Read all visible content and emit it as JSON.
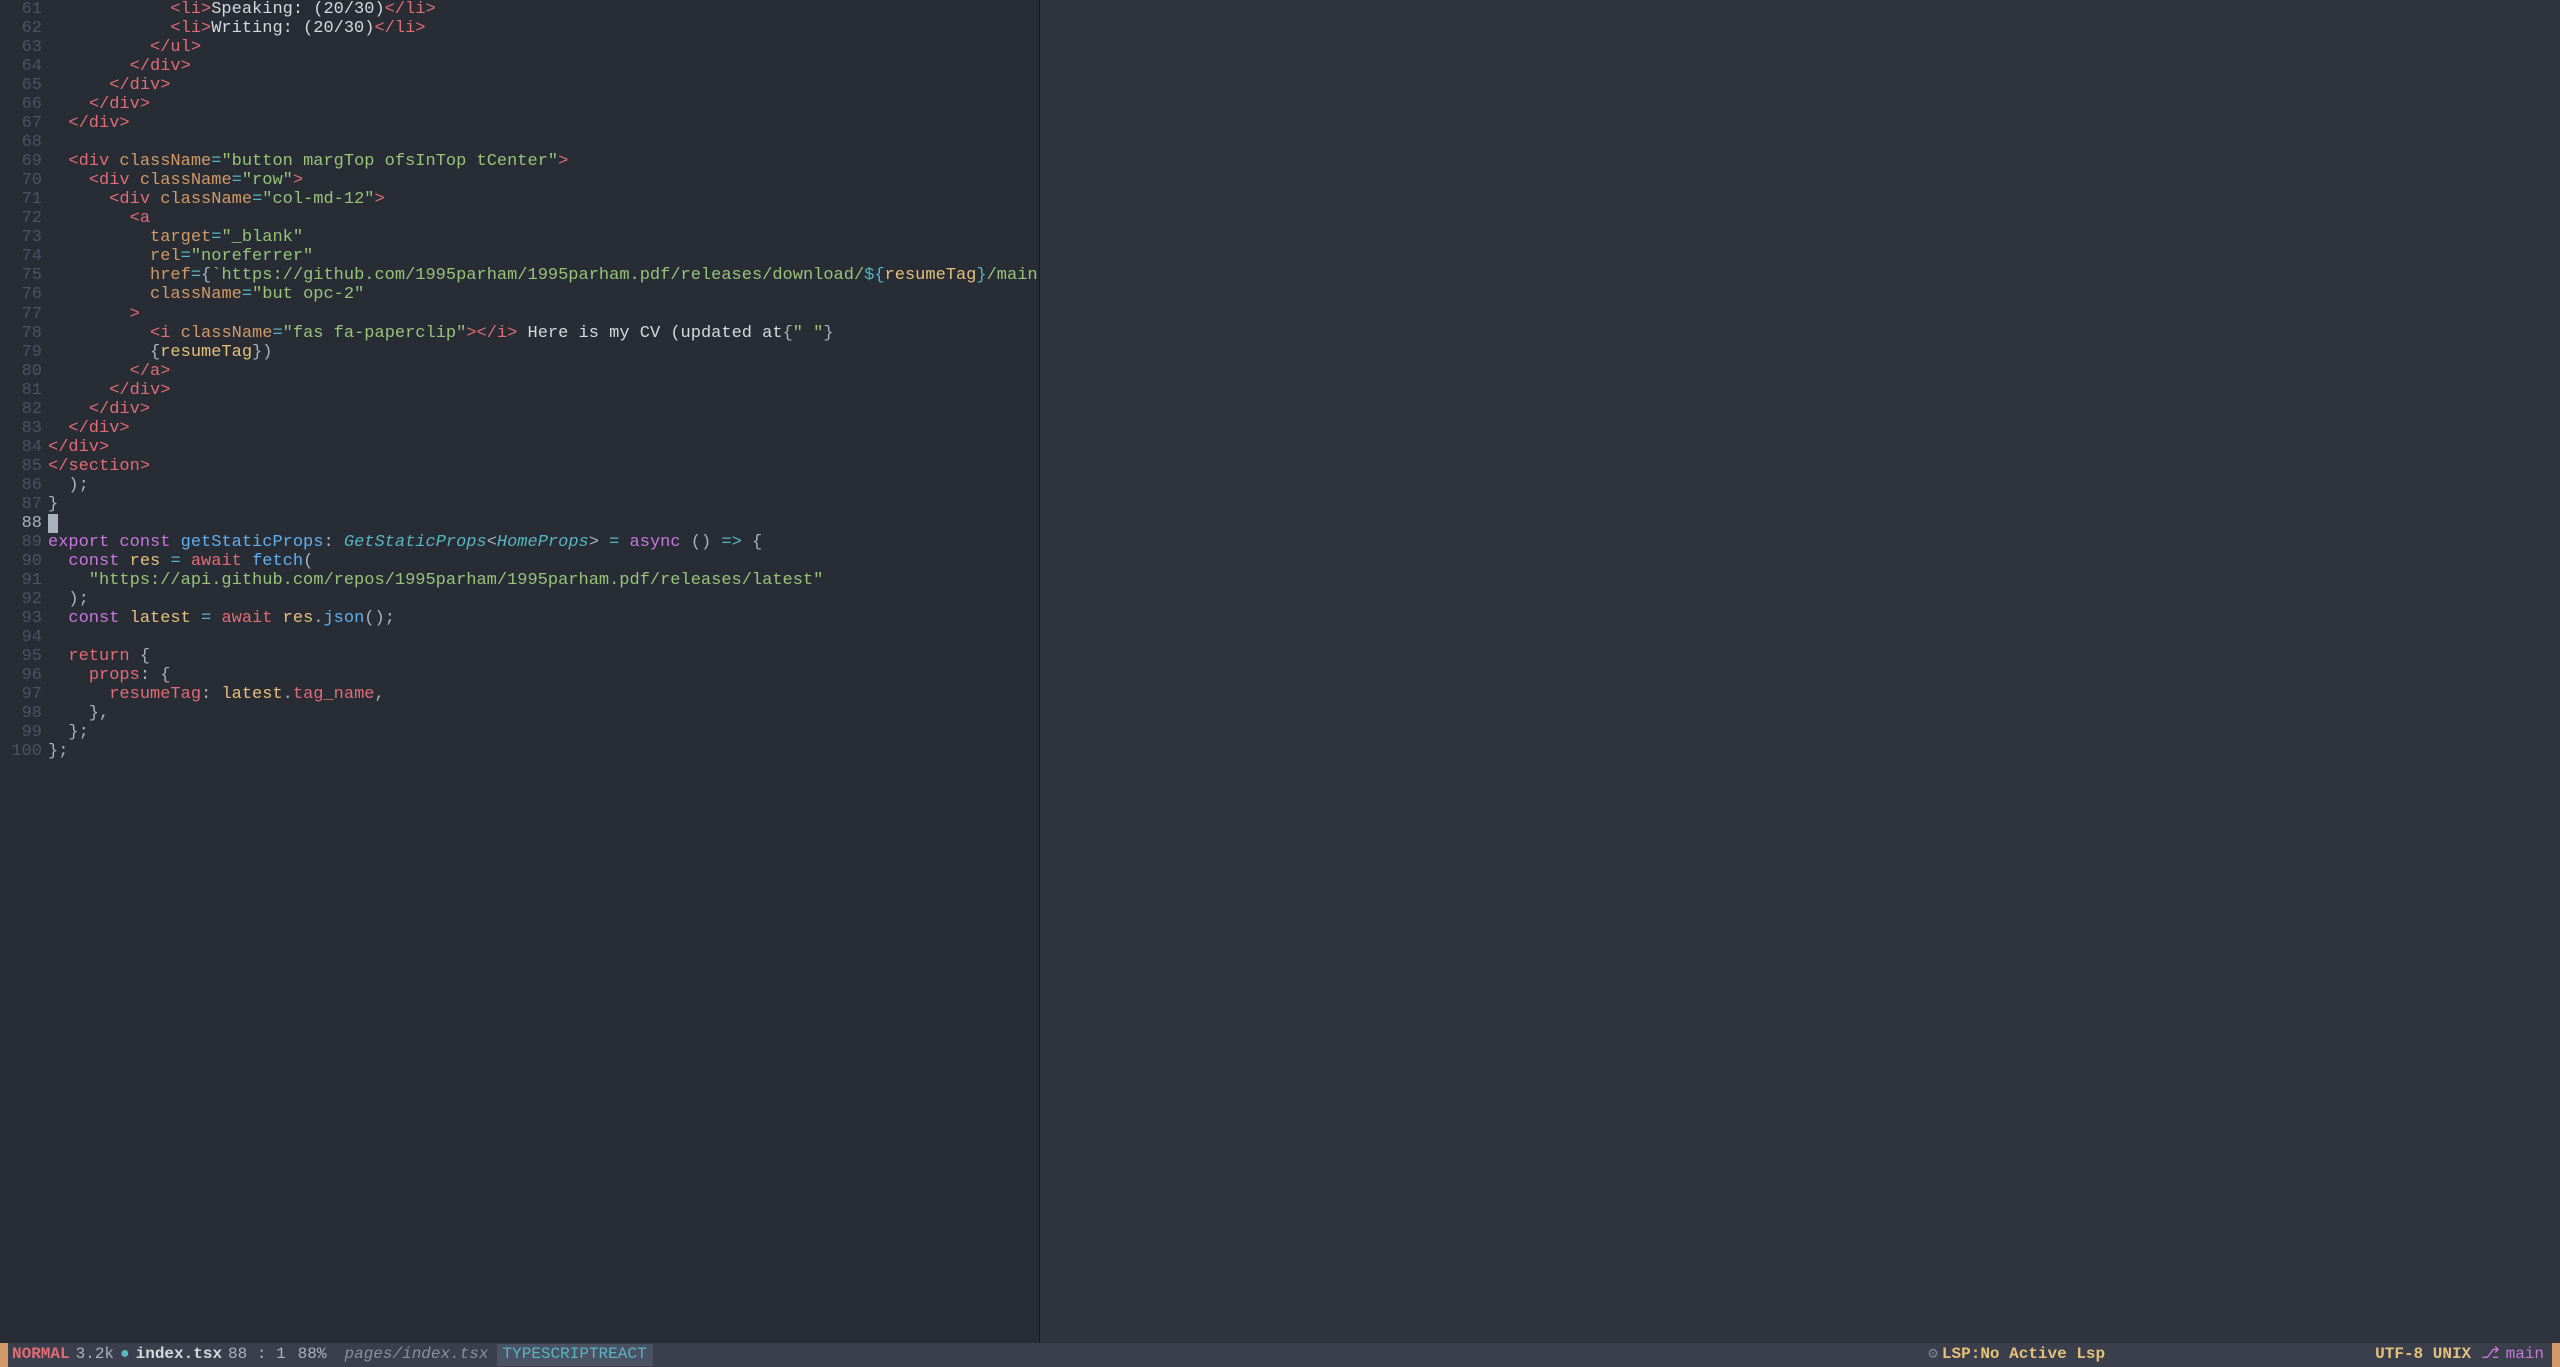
{
  "status": {
    "mode": "NORMAL",
    "filesize": "3.2k",
    "modified_dot": "●",
    "filename": "index.tsx",
    "line": "88",
    "col": "1",
    "percent": "88%",
    "relpath": "pages/index.tsx",
    "filetype": "TYPESCRIPTREACT",
    "lsp_icon": "⚙",
    "lsp": "LSP:No Active Lsp",
    "encoding": "UTF-8 UNIX",
    "branch_icon": "⎇",
    "branch": "main"
  },
  "cursor_line": 88,
  "lines": [
    {
      "n": 61,
      "tokens": [
        [
          "c-punct",
          "            "
        ],
        [
          "c-tag",
          "<li>"
        ],
        [
          "c-text",
          "Speaking: (20/30)"
        ],
        [
          "c-tag",
          "</li>"
        ]
      ]
    },
    {
      "n": 62,
      "tokens": [
        [
          "c-punct",
          "            "
        ],
        [
          "c-tag",
          "<li>"
        ],
        [
          "c-text",
          "Writing: (20/30)"
        ],
        [
          "c-tag",
          "</li>"
        ]
      ]
    },
    {
      "n": 63,
      "tokens": [
        [
          "c-punct",
          "          "
        ],
        [
          "c-tag",
          "</ul>"
        ]
      ]
    },
    {
      "n": 64,
      "tokens": [
        [
          "c-punct",
          "        "
        ],
        [
          "c-tag",
          "</div>"
        ]
      ]
    },
    {
      "n": 65,
      "tokens": [
        [
          "c-punct",
          "      "
        ],
        [
          "c-tag",
          "</div>"
        ]
      ]
    },
    {
      "n": 66,
      "tokens": [
        [
          "c-punct",
          "    "
        ],
        [
          "c-tag",
          "</div>"
        ]
      ]
    },
    {
      "n": 67,
      "tokens": [
        [
          "c-punct",
          "  "
        ],
        [
          "c-tag",
          "</div>"
        ]
      ]
    },
    {
      "n": 68,
      "tokens": []
    },
    {
      "n": 69,
      "tokens": [
        [
          "c-punct",
          "  "
        ],
        [
          "c-tag",
          "<div "
        ],
        [
          "c-attr",
          "className"
        ],
        [
          "c-op",
          "="
        ],
        [
          "c-str",
          "\"button margTop ofsInTop tCenter\""
        ],
        [
          "c-tag",
          ">"
        ]
      ]
    },
    {
      "n": 70,
      "tokens": [
        [
          "c-punct",
          "    "
        ],
        [
          "c-tag",
          "<div "
        ],
        [
          "c-attr",
          "className"
        ],
        [
          "c-op",
          "="
        ],
        [
          "c-str",
          "\"row\""
        ],
        [
          "c-tag",
          ">"
        ]
      ]
    },
    {
      "n": 71,
      "tokens": [
        [
          "c-punct",
          "      "
        ],
        [
          "c-tag",
          "<div "
        ],
        [
          "c-attr",
          "className"
        ],
        [
          "c-op",
          "="
        ],
        [
          "c-str",
          "\"col-md-12\""
        ],
        [
          "c-tag",
          ">"
        ]
      ]
    },
    {
      "n": 72,
      "tokens": [
        [
          "c-punct",
          "        "
        ],
        [
          "c-tag",
          "<a"
        ]
      ]
    },
    {
      "n": 73,
      "tokens": [
        [
          "c-punct",
          "          "
        ],
        [
          "c-attr",
          "target"
        ],
        [
          "c-op",
          "="
        ],
        [
          "c-str",
          "\"_blank\""
        ]
      ]
    },
    {
      "n": 74,
      "tokens": [
        [
          "c-punct",
          "          "
        ],
        [
          "c-attr",
          "rel"
        ],
        [
          "c-op",
          "="
        ],
        [
          "c-str",
          "\"noreferrer\""
        ]
      ]
    },
    {
      "n": 75,
      "tokens": [
        [
          "c-punct",
          "          "
        ],
        [
          "c-attr",
          "href"
        ],
        [
          "c-op",
          "="
        ],
        [
          "c-punct",
          "{"
        ],
        [
          "c-str",
          "`https://github.com/1995parham/1995parham.pdf/releases/download/"
        ],
        [
          "c-op",
          "${"
        ],
        [
          "c-var",
          "resumeTag"
        ],
        [
          "c-op",
          "}"
        ],
        [
          "c-str",
          "/main.pdf`"
        ],
        [
          "c-punct",
          "}"
        ]
      ]
    },
    {
      "n": 76,
      "tokens": [
        [
          "c-punct",
          "          "
        ],
        [
          "c-attr",
          "className"
        ],
        [
          "c-op",
          "="
        ],
        [
          "c-str",
          "\"but opc-2\""
        ]
      ]
    },
    {
      "n": 77,
      "tokens": [
        [
          "c-punct",
          "        "
        ],
        [
          "c-tag",
          ">"
        ]
      ]
    },
    {
      "n": 78,
      "tokens": [
        [
          "c-punct",
          "          "
        ],
        [
          "c-tag",
          "<i "
        ],
        [
          "c-attr",
          "className"
        ],
        [
          "c-op",
          "="
        ],
        [
          "c-str",
          "\"fas fa-paperclip\""
        ],
        [
          "c-tag",
          "></i>"
        ],
        [
          "c-text",
          " Here is my CV (updated at"
        ],
        [
          "c-punct",
          "{"
        ],
        [
          "c-str",
          "\" \""
        ],
        [
          "c-punct",
          "}"
        ]
      ]
    },
    {
      "n": 79,
      "tokens": [
        [
          "c-punct",
          "          {"
        ],
        [
          "c-var",
          "resumeTag"
        ],
        [
          "c-punct",
          "})"
        ]
      ]
    },
    {
      "n": 80,
      "tokens": [
        [
          "c-punct",
          "        "
        ],
        [
          "c-tag",
          "</a>"
        ]
      ]
    },
    {
      "n": 81,
      "tokens": [
        [
          "c-punct",
          "      "
        ],
        [
          "c-tag",
          "</div>"
        ]
      ]
    },
    {
      "n": 82,
      "tokens": [
        [
          "c-punct",
          "    "
        ],
        [
          "c-tag",
          "</div>"
        ]
      ]
    },
    {
      "n": 83,
      "tokens": [
        [
          "c-punct",
          "  "
        ],
        [
          "c-tag",
          "</div>"
        ]
      ]
    },
    {
      "n": 84,
      "tokens": [
        [
          "c-tag",
          "</div>"
        ]
      ]
    },
    {
      "n": 85,
      "tokens": [
        [
          "c-tag",
          "</section>"
        ]
      ]
    },
    {
      "n": 86,
      "tokens": [
        [
          "c-punct",
          "  );"
        ]
      ]
    },
    {
      "n": 87,
      "tokens": [
        [
          "c-punct",
          "}"
        ]
      ]
    },
    {
      "n": 88,
      "tokens": [
        [
          "cursor",
          ""
        ]
      ]
    },
    {
      "n": 89,
      "tokens": [
        [
          "c-kw",
          "export "
        ],
        [
          "c-kw",
          "const "
        ],
        [
          "c-fn",
          "getStaticProps"
        ],
        [
          "c-punct",
          ": "
        ],
        [
          "c-type",
          "GetStaticProps"
        ],
        [
          "c-punct",
          "<"
        ],
        [
          "c-type",
          "HomeProps"
        ],
        [
          "c-punct",
          "> "
        ],
        [
          "c-op",
          "= "
        ],
        [
          "c-kw",
          "async "
        ],
        [
          "c-punct",
          "() "
        ],
        [
          "c-op",
          "=> "
        ],
        [
          "c-punct",
          "{"
        ]
      ]
    },
    {
      "n": 90,
      "tokens": [
        [
          "c-punct",
          "  "
        ],
        [
          "c-kw",
          "const "
        ],
        [
          "c-var",
          "res"
        ],
        [
          "c-punct",
          " "
        ],
        [
          "c-op",
          "= "
        ],
        [
          "c-kw2",
          "await "
        ],
        [
          "c-fn",
          "fetch"
        ],
        [
          "c-punct",
          "("
        ]
      ]
    },
    {
      "n": 91,
      "tokens": [
        [
          "c-punct",
          "    "
        ],
        [
          "c-str",
          "\"https://api.github.com/repos/1995parham/1995parham.pdf/releases/latest\""
        ]
      ]
    },
    {
      "n": 92,
      "tokens": [
        [
          "c-punct",
          "  );"
        ]
      ]
    },
    {
      "n": 93,
      "tokens": [
        [
          "c-punct",
          "  "
        ],
        [
          "c-kw",
          "const "
        ],
        [
          "c-var",
          "latest"
        ],
        [
          "c-punct",
          " "
        ],
        [
          "c-op",
          "= "
        ],
        [
          "c-kw2",
          "await "
        ],
        [
          "c-var",
          "res"
        ],
        [
          "c-punct",
          "."
        ],
        [
          "c-fn",
          "json"
        ],
        [
          "c-punct",
          "();"
        ]
      ]
    },
    {
      "n": 94,
      "tokens": []
    },
    {
      "n": 95,
      "tokens": [
        [
          "c-punct",
          "  "
        ],
        [
          "c-kw2",
          "return "
        ],
        [
          "c-punct",
          "{"
        ]
      ]
    },
    {
      "n": 96,
      "tokens": [
        [
          "c-punct",
          "    "
        ],
        [
          "c-prop",
          "props"
        ],
        [
          "c-punct",
          ": {"
        ]
      ]
    },
    {
      "n": 97,
      "tokens": [
        [
          "c-punct",
          "      "
        ],
        [
          "c-prop",
          "resumeTag"
        ],
        [
          "c-punct",
          ": "
        ],
        [
          "c-var",
          "latest"
        ],
        [
          "c-punct",
          "."
        ],
        [
          "c-prop",
          "tag_name"
        ],
        [
          "c-punct",
          ","
        ]
      ]
    },
    {
      "n": 98,
      "tokens": [
        [
          "c-punct",
          "    },"
        ]
      ]
    },
    {
      "n": 99,
      "tokens": [
        [
          "c-punct",
          "  };"
        ]
      ]
    },
    {
      "n": 100,
      "tokens": [
        [
          "c-punct",
          "};"
        ]
      ]
    }
  ]
}
